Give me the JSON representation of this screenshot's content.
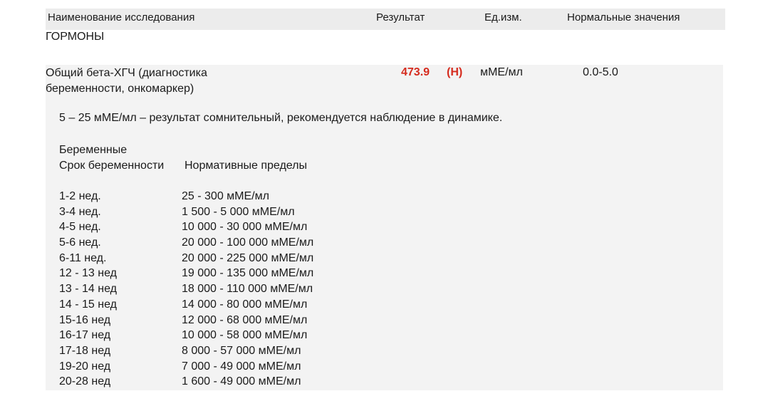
{
  "header": {
    "col_name": "Наименование исследования",
    "col_result": "Результат",
    "col_unit": "Ед.изм.",
    "col_reference": "Нормальные значения"
  },
  "section": {
    "title": "ГОРМОНЫ"
  },
  "test": {
    "name_line1": "Общий бета-ХГЧ (диагностика",
    "name_line2": "беременности, онкомаркер)",
    "result": "473.9",
    "flag": "(H)",
    "unit": "мМЕ/мл",
    "reference": "0.0-5.0",
    "flag_color": "#d52b1e"
  },
  "comment": {
    "note": "5 – 25 мМЕ/мл – результат сомнительный, рекомендуется наблюдение в динамике.",
    "pregnant_title": "Беременные",
    "col_term": "Срок беременности",
    "col_limits": "Нормативные пределы"
  },
  "norms": [
    {
      "term": "1-2 нед.",
      "range": "25 - 300 мМЕ/мл"
    },
    {
      "term": "3-4 нед.",
      "range": "1 500 - 5 000 мМЕ/мл"
    },
    {
      "term": "4-5 нед.",
      "range": "10 000 - 30 000 мМЕ/мл"
    },
    {
      "term": "5-6 нед.",
      "range": "20 000 - 100 000 мМЕ/мл"
    },
    {
      "term": "6-11 нед.",
      "range": "20 000 - 225 000 мМЕ/мл"
    },
    {
      "term": "12 - 13 нед",
      "range": "19 000 - 135 000 мМЕ/мл"
    },
    {
      "term": "13 - 14 нед",
      "range": "18 000 - 110 000 мМЕ/мл"
    },
    {
      "term": "14 - 15 нед",
      "range": "14 000 - 80 000 мМЕ/мл"
    },
    {
      "term": "15-16 нед",
      "range": "12 000 - 68 000 мМЕ/мл"
    },
    {
      "term": "16-17 нед",
      "range": "10 000 - 58 000 мМЕ/мл"
    },
    {
      "term": "17-18 нед",
      "range": "8 000 - 57 000 мМЕ/мл"
    },
    {
      "term": "19-20 нед",
      "range": "7 000 - 49 000 мМЕ/мл"
    },
    {
      "term": "20-28 нед",
      "range": "1 600 - 49 000 мМЕ/мл"
    }
  ]
}
